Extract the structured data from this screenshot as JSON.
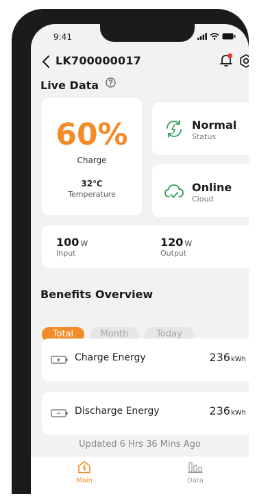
{
  "status_bar": {
    "time": "9:41"
  },
  "header": {
    "device_id": "LK700000017"
  },
  "live_data": {
    "title": "Live Data",
    "charge": {
      "value": "60%",
      "label": "Charge"
    },
    "temperature": {
      "value": "32℃",
      "label": "Temperature"
    },
    "status": {
      "value": "Normal",
      "label": "Status"
    },
    "cloud": {
      "value": "Online",
      "label": "Cloud"
    },
    "input": {
      "value": "100",
      "unit": "W",
      "label": "Input"
    },
    "output": {
      "value": "120",
      "unit": "W",
      "label": "Output"
    }
  },
  "benefits": {
    "title": "Benefits Overview",
    "tabs": [
      {
        "label": "Total",
        "active": true
      },
      {
        "label": "Month",
        "active": false
      },
      {
        "label": "Today",
        "active": false
      }
    ],
    "items": [
      {
        "label": "Charge Energy",
        "value": "236",
        "unit": "kWh"
      },
      {
        "label": "Discharge Energy",
        "value": "236",
        "unit": "kWh"
      }
    ]
  },
  "updated_text": "Updated 6 Hrs 36 Mins Ago",
  "tabbar": {
    "items": [
      {
        "label": "Main",
        "active": true
      },
      {
        "label": "Data",
        "active": false
      }
    ]
  },
  "colors": {
    "accent": "#f28c28",
    "status_green": "#2e9e5b",
    "notification": "#e53935"
  }
}
